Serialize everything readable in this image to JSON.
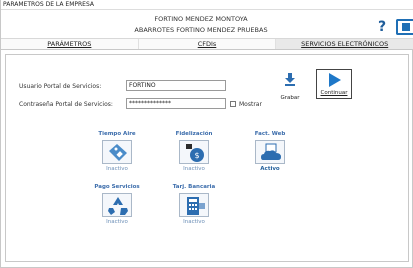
{
  "window": {
    "title": "PARAMETROS DE LA EMPRESA"
  },
  "header": {
    "user_name": "FORTINO MENDEZ MONTOYA",
    "company_name": "ABARROTES FORTINO MENDEZ PRUEBAS",
    "help_label": "?"
  },
  "tabs": [
    {
      "label": "PARÁMETROS",
      "active": false
    },
    {
      "label": "CFDIs",
      "active": false
    },
    {
      "label": "SERVICIOS ELECTRÓNICOS",
      "active": true
    }
  ],
  "form": {
    "user_label": "Usuario Portal de Servicios:",
    "user_value": "FORTINO",
    "password_label": "Contraseña Portal de Servicios:",
    "password_value": "**************",
    "show_label": "Mostrar"
  },
  "actions": {
    "save_label": "Grabar",
    "continue_label": "Continuar"
  },
  "services": [
    {
      "title": "Tiempo Aire",
      "status": "Inactivo",
      "active": false,
      "icon": "phone-tag-icon"
    },
    {
      "title": "Fidelización",
      "status": "Inactivo",
      "active": false,
      "icon": "money-bag-icon"
    },
    {
      "title": "Fact. Web",
      "status": "Activo",
      "active": true,
      "icon": "cloud-document-icon"
    },
    {
      "title": "Pago Servicios",
      "status": "Inactivo",
      "active": false,
      "icon": "recycle-icon"
    },
    {
      "title": "Tarj. Bancaria",
      "status": "Inactivo",
      "active": false,
      "icon": "card-terminal-icon"
    }
  ],
  "colors": {
    "accent": "#1f78c8",
    "service_title": "#3b6cab",
    "inactive_status": "#6c8fb7"
  }
}
